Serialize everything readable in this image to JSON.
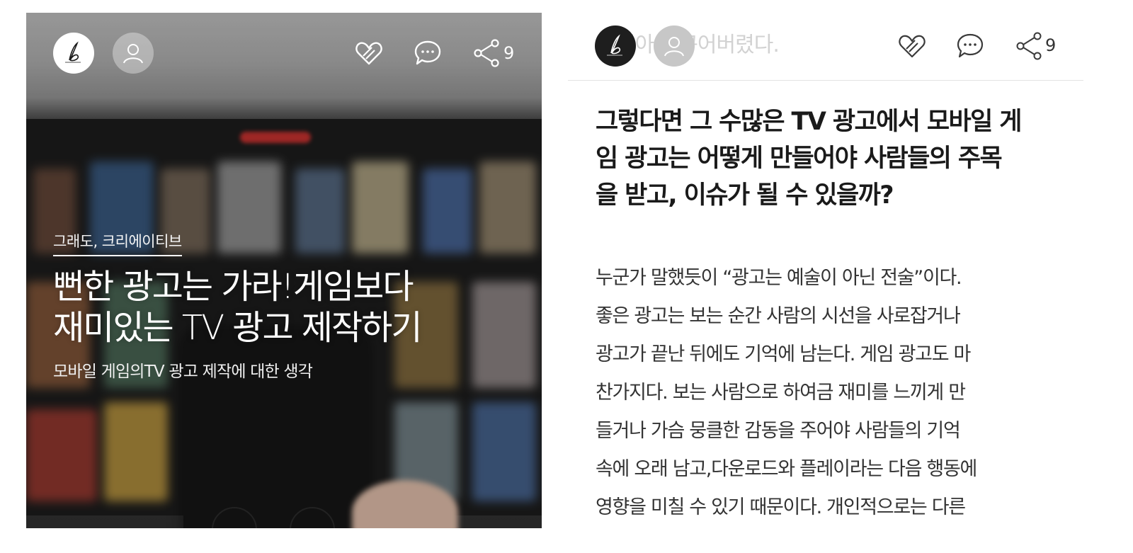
{
  "left": {
    "share_count": "9",
    "magazine": "그래도, 크리에이티브",
    "title_lines": [
      "뻔한 광고는 가라!게임보다",
      "재미있는 TV 광고 제작하기"
    ],
    "subtitle": "모바일 게임의TV 광고 제작에 대한 생각"
  },
  "right": {
    "share_count": "9",
    "header_ghost": "좋아 바꾸어버렸다.",
    "heading_lines": [
      "그렇다면 그 수많은 TV 광고에서 모바일 게",
      "임 광고는 어떻게 만들어야 사람들의 주목",
      "을 받고, 이슈가 될 수 있을까?"
    ],
    "body_lines": [
      "누군가 말했듯이 “광고는 예술이 아닌 전술”이다.",
      "좋은 광고는 보는 순간 사람의 시선을 사로잡거나",
      "광고가 끝난 뒤에도 기억에 남는다. 게임 광고도 마",
      "찬가지다. 보는 사람으로 하여금 재미를 느끼게 만",
      "들거나 가슴 뭉클한 감동을 주어야 사람들의 기억",
      "속에 오래 남고,다운로드와 플레이라는 다음 행동에",
      "영향을 미칠 수 있기 때문이다. 개인적으로는 다른"
    ]
  },
  "icons": {
    "author_logo": "signature-b-logo",
    "user": "user-icon",
    "like": "heart-icon",
    "comment": "comment-icon",
    "share": "share-icon"
  },
  "colors": {
    "text_dark": "#1a1a1a",
    "body_text": "#333333",
    "icon_light": "#ffffff",
    "icon_dark": "#3a3a3a",
    "divider": "#e3e3e3"
  }
}
